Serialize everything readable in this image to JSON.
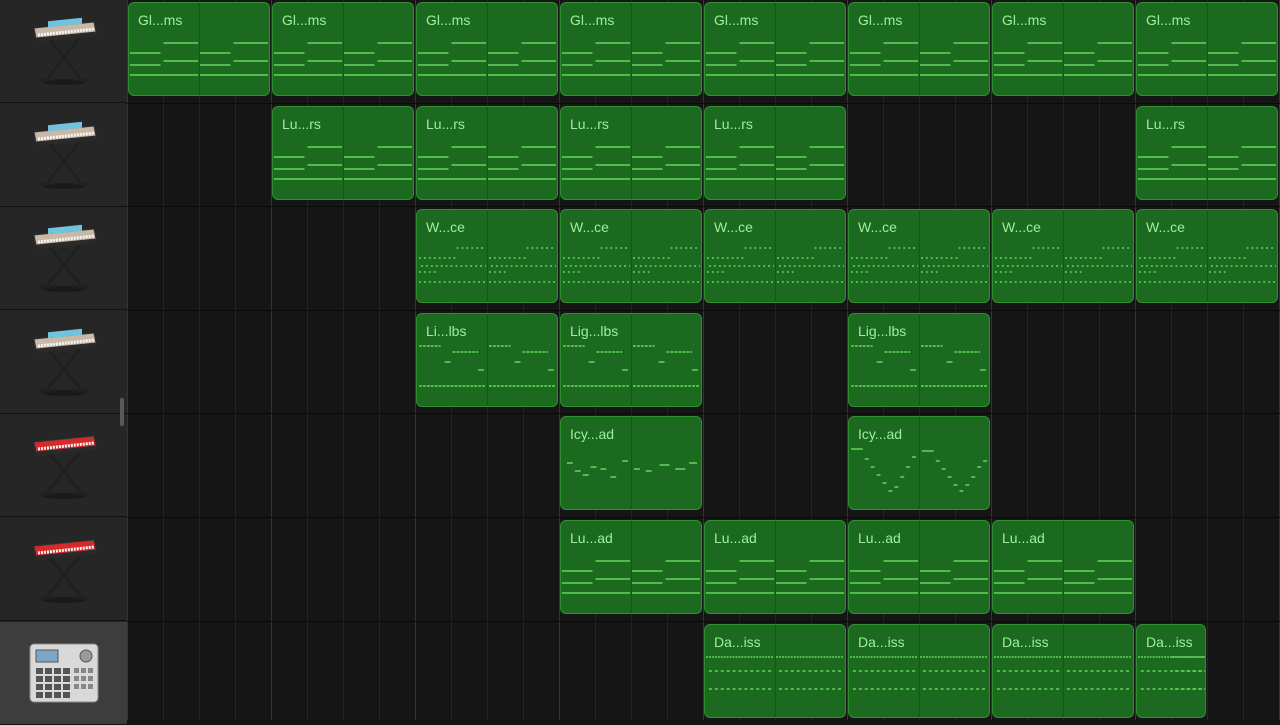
{
  "tracks": [
    {
      "icon": "keyboard-stand-icon",
      "keyboard_color": "#c9b8a6"
    },
    {
      "icon": "keyboard-stand-icon",
      "keyboard_color": "#c9b8a6"
    },
    {
      "icon": "keyboard-stand-icon",
      "keyboard_color": "#c9b8a6"
    },
    {
      "icon": "keyboard-stand-icon",
      "keyboard_color": "#c9b8a6"
    },
    {
      "icon": "red-synth-keyboard-icon",
      "keyboard_color": "#d42a2a"
    },
    {
      "icon": "red-synth-keyboard-icon",
      "keyboard_color": "#d42a2a"
    },
    {
      "icon": "drum-machine-icon",
      "keyboard_color": "#d6d6d6",
      "selected": true
    }
  ],
  "regions": [
    {
      "track": 0,
      "bar": 0,
      "label": "Gl...ms",
      "pattern": "A"
    },
    {
      "track": 0,
      "bar": 1,
      "label": "Gl...ms",
      "pattern": "A"
    },
    {
      "track": 0,
      "bar": 2,
      "label": "Gl...ms",
      "pattern": "A"
    },
    {
      "track": 0,
      "bar": 3,
      "label": "Gl...ms",
      "pattern": "A"
    },
    {
      "track": 0,
      "bar": 4,
      "label": "Gl...ms",
      "pattern": "A"
    },
    {
      "track": 0,
      "bar": 5,
      "label": "Gl...ms",
      "pattern": "A"
    },
    {
      "track": 0,
      "bar": 6,
      "label": "Gl...ms",
      "pattern": "A"
    },
    {
      "track": 0,
      "bar": 7,
      "label": "Gl...ms",
      "pattern": "A"
    },
    {
      "track": 1,
      "bar": 1,
      "label": "Lu...rs",
      "pattern": "A"
    },
    {
      "track": 1,
      "bar": 2,
      "label": "Lu...rs",
      "pattern": "A"
    },
    {
      "track": 1,
      "bar": 3,
      "label": "Lu...rs",
      "pattern": "A"
    },
    {
      "track": 1,
      "bar": 4,
      "label": "Lu...rs",
      "pattern": "A"
    },
    {
      "track": 1,
      "bar": 7,
      "label": "Lu...rs",
      "pattern": "A"
    },
    {
      "track": 2,
      "bar": 2,
      "label": "W...ce",
      "pattern": "B"
    },
    {
      "track": 2,
      "bar": 3,
      "label": "W...ce",
      "pattern": "B"
    },
    {
      "track": 2,
      "bar": 4,
      "label": "W...ce",
      "pattern": "B"
    },
    {
      "track": 2,
      "bar": 5,
      "label": "W...ce",
      "pattern": "B"
    },
    {
      "track": 2,
      "bar": 6,
      "label": "W...ce",
      "pattern": "B"
    },
    {
      "track": 2,
      "bar": 7,
      "label": "W...ce",
      "pattern": "B"
    },
    {
      "track": 3,
      "bar": 2,
      "label": "Li...lbs",
      "pattern": "C"
    },
    {
      "track": 3,
      "bar": 3,
      "label": "Lig...lbs",
      "pattern": "C"
    },
    {
      "track": 3,
      "bar": 5,
      "label": "Lig...lbs",
      "pattern": "C"
    },
    {
      "track": 4,
      "bar": 3,
      "label": "Icy...ad",
      "pattern": "D"
    },
    {
      "track": 4,
      "bar": 5,
      "label": "Icy...ad",
      "pattern": "E"
    },
    {
      "track": 5,
      "bar": 3,
      "label": "Lu...ad",
      "pattern": "A"
    },
    {
      "track": 5,
      "bar": 4,
      "label": "Lu...ad",
      "pattern": "A"
    },
    {
      "track": 5,
      "bar": 5,
      "label": "Lu...ad",
      "pattern": "A"
    },
    {
      "track": 5,
      "bar": 6,
      "label": "Lu...ad",
      "pattern": "A"
    },
    {
      "track": 6,
      "bar": 4,
      "label": "Da...iss",
      "pattern": "F"
    },
    {
      "track": 6,
      "bar": 5,
      "label": "Da...iss",
      "pattern": "F"
    },
    {
      "track": 6,
      "bar": 6,
      "label": "Da...iss",
      "pattern": "F"
    },
    {
      "track": 6,
      "bar": 7,
      "label": "Da...iss",
      "pattern": "F",
      "half": true
    }
  ]
}
